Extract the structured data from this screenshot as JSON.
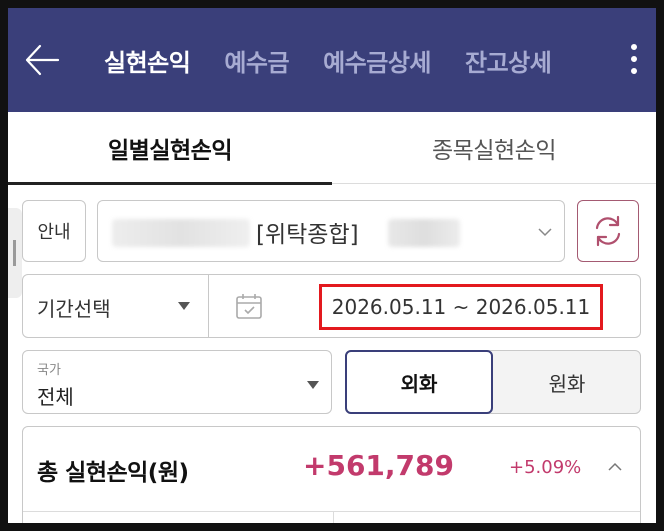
{
  "header": {
    "back_icon": "arrow-left-icon",
    "tabs": [
      {
        "label": "실현손익",
        "active": true
      },
      {
        "label": "예수금",
        "active": false
      },
      {
        "label": "예수금상세",
        "active": false
      },
      {
        "label": "잔고상세",
        "active": false
      }
    ],
    "menu_icon": "kebab-menu-icon"
  },
  "subtabs": [
    {
      "label": "일별실현손익",
      "active": true
    },
    {
      "label": "종목실현손익",
      "active": false
    }
  ],
  "account_row": {
    "info_button": "안내",
    "account_label": "[위탁종합]",
    "refresh_icon": "refresh-icon"
  },
  "period_row": {
    "select_label": "기간선택",
    "calendar_icon": "calendar-icon",
    "date_range": "2026.05.11 ~ 2026.05.11"
  },
  "filter_row": {
    "country_caption": "국가",
    "country_value": "전체",
    "currency_options": [
      {
        "label": "외화",
        "selected": true
      },
      {
        "label": "원화",
        "selected": false
      }
    ]
  },
  "summary": {
    "title": "총 실현손익(원)",
    "amount": "+561,789",
    "percent": "+5.09%"
  },
  "colors": {
    "header_bg": "#3a3f7a",
    "profit": "#c23a6c",
    "highlight_border": "#e3191e"
  }
}
